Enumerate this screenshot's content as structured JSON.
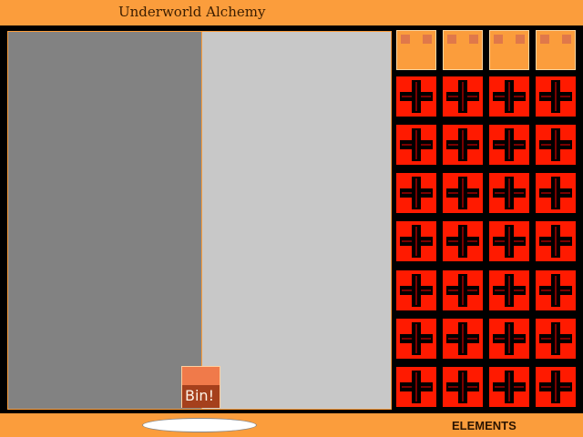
{
  "window": {
    "title": "Underworld Alchemy"
  },
  "workspace": {
    "bin_label": "Bin!"
  },
  "footer": {
    "search_value": "",
    "elements_label": "ELEMENTS"
  },
  "palette": {
    "header_slots": 4,
    "rows": 7,
    "cols": 4,
    "tile_icon": "plus-cross-icon",
    "colors": {
      "frame": "#fb9d3c",
      "tile": "#ff1a00",
      "cross": "#000000"
    }
  }
}
